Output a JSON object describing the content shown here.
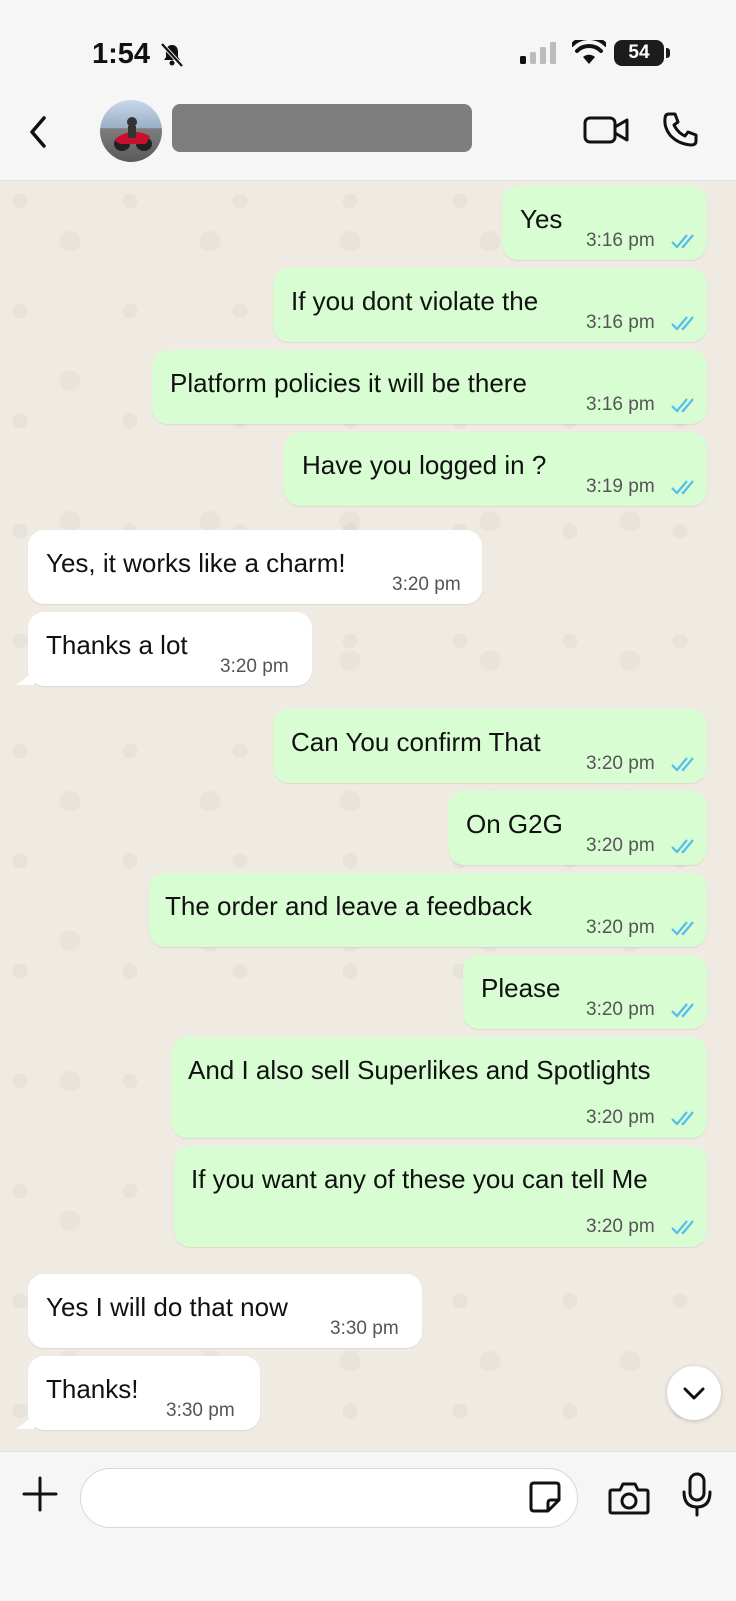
{
  "status_bar": {
    "time": "1:54",
    "battery": "54"
  },
  "header": {
    "contact_name": ""
  },
  "messages": [
    {
      "dir": "out",
      "text": "Yes",
      "time": "3:16 pm"
    },
    {
      "dir": "out",
      "text": "If you dont violate the",
      "time": "3:16 pm"
    },
    {
      "dir": "out",
      "text": "Platform policies it will be there",
      "time": "3:16 pm"
    },
    {
      "dir": "out",
      "text": "Have you logged in ?",
      "time": "3:19 pm"
    },
    {
      "dir": "in",
      "text": "Yes, it works like a charm!",
      "time": "3:20 pm"
    },
    {
      "dir": "in",
      "text": "Thanks a lot",
      "time": "3:20 pm"
    },
    {
      "dir": "out",
      "text": "Can You confirm That",
      "time": "3:20 pm"
    },
    {
      "dir": "out",
      "text": "On G2G",
      "time": "3:20 pm"
    },
    {
      "dir": "out",
      "text": "The order and leave a feedback",
      "time": "3:20 pm"
    },
    {
      "dir": "out",
      "text": "Please",
      "time": "3:20 pm"
    },
    {
      "dir": "out",
      "text": "And I also sell Superlikes and Spotlights",
      "time": "3:20 pm"
    },
    {
      "dir": "out",
      "text": "If you want any of these you can tell Me",
      "time": "3:20 pm"
    },
    {
      "dir": "in",
      "text": "Yes I will do that now",
      "time": "3:30 pm"
    },
    {
      "dir": "in",
      "text": "Thanks!",
      "time": "3:30 pm"
    }
  ],
  "composer": {
    "placeholder": ""
  },
  "colors": {
    "outgoing_bubble": "#d9fdd3",
    "incoming_bubble": "#ffffff",
    "read_ticks": "#53bdeb",
    "chat_bg": "#efeae2"
  }
}
